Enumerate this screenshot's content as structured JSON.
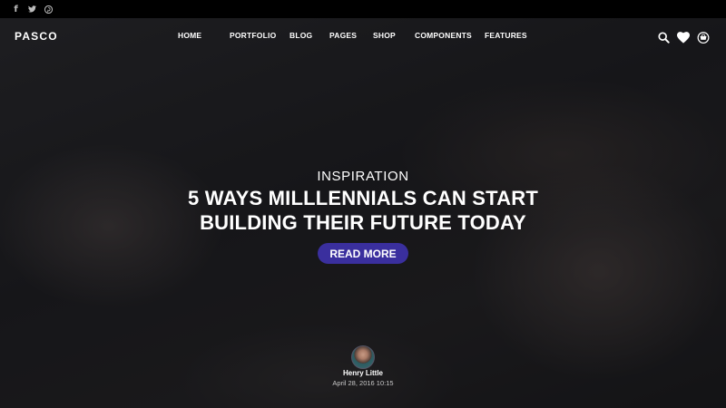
{
  "social": {
    "items": [
      {
        "icon": "facebook-icon",
        "glyph": "f"
      },
      {
        "icon": "twitter-icon",
        "glyph": "t"
      },
      {
        "icon": "pinterest-icon",
        "glyph": "p"
      }
    ]
  },
  "nav": {
    "logo": "PASCO",
    "items": [
      "HOME",
      "PORTFOLIO",
      "BLOG",
      "PAGES",
      "SHOP",
      "COMPONENTS",
      "FEATURES"
    ],
    "icons": [
      "search-icon",
      "heart-icon",
      "cart-icon"
    ]
  },
  "hero": {
    "category": "INSPIRATION",
    "title_line1": "5 WAYS MILLLENNIALS CAN START",
    "title_line2": "BUILDING THEIR FUTURE TODAY",
    "button_label": "READ MORE",
    "button_color": "#3a2f9e"
  },
  "post": {
    "author": "Henry Little",
    "date": "April 28, 2016 10:15"
  }
}
